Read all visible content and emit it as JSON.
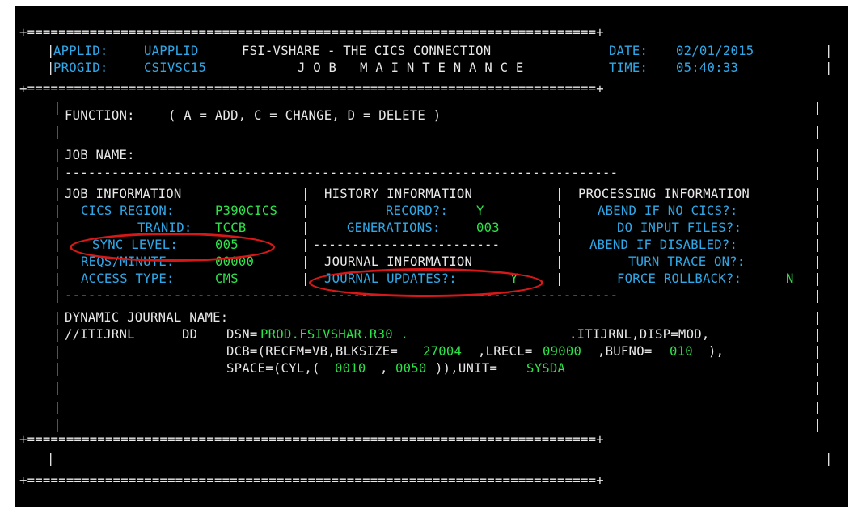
{
  "border_lines": {
    "top": "+=========================================================================+",
    "header_sep": "+=========================================================================+",
    "footer_sep": "+=========================================================================+",
    "bottom": "+=========================================================================+",
    "dash_1": "-----------------------------------------------------------------------",
    "dash_2": "-----------------------------------------------------------------------",
    "history_dash": "------------------------"
  },
  "header": {
    "applid_label": "APPLID:",
    "applid_value": "UAPPLID",
    "app_title": "FSI-VSHARE - THE CICS CONNECTION",
    "date_label": "DATE:",
    "date_value": "02/01/2015",
    "progid_label": "PROGID:",
    "progid_value": "CSIVSC15",
    "screen_title": "J O B   M A I N T E N A N C E",
    "time_label": "TIME:",
    "time_value": "05:40:33"
  },
  "function_line": {
    "label": "FUNCTION:",
    "options": "( A = ADD, C = CHANGE, D = DELETE )"
  },
  "job_name": {
    "label": "JOB NAME:"
  },
  "job_information": {
    "heading": "JOB INFORMATION",
    "cics_region_label": "CICS REGION:",
    "cics_region_value": "P390CICS",
    "tranid_label": "TRANID:",
    "tranid_value": "TCCB",
    "sync_level_label": "SYNC LEVEL:",
    "sync_level_value": "005",
    "reqs_minute_label": "REQS/MINUTE:",
    "reqs_minute_value": "00000",
    "access_type_label": "ACCESS TYPE:",
    "access_type_value": "CMS"
  },
  "history_information": {
    "heading": "HISTORY INFORMATION",
    "record_label": "RECORD?:",
    "record_value": "Y",
    "generations_label": "GENERATIONS:",
    "generations_value": "003"
  },
  "journal_information": {
    "heading": "JOURNAL INFORMATION",
    "journal_updates_label": "JOURNAL UPDATES?:",
    "journal_updates_value": "Y"
  },
  "processing_information": {
    "heading": "PROCESSING INFORMATION",
    "abend_no_cics_label": "ABEND IF NO CICS?:",
    "do_input_files_label": "DO INPUT FILES?:",
    "abend_disabled_label": "ABEND IF DISABLED?:",
    "turn_trace_label": "TURN TRACE ON?:",
    "force_rollback_label": "FORCE ROLLBACK?:",
    "force_rollback_value": "N"
  },
  "dynamic_journal": {
    "heading": "DYNAMIC JOURNAL NAME:",
    "ddname": "//ITIJRNL",
    "dd": "DD",
    "dsn_label": "DSN=",
    "dsn_prefix": "PROD.FSIVSHAR.R30 .",
    "dsn_suffix": ".ITIJRNL,DISP=MOD,",
    "dcb_open": "DCB=(RECFM=VB,BLKSIZE=",
    "blksize_value": "27004",
    "lrecl_label": ",LRECL=",
    "lrecl_value": "09000",
    "bufno_label": ",BUFNO=",
    "bufno_value": "010",
    "dcb_close": "),",
    "space_open": "SPACE=(CYL,(",
    "primary_value": "0010",
    "comma": ",",
    "secondary_value": "0050",
    "space_close": ")),UNIT=",
    "unit_value": "SYSDA"
  },
  "colors": {
    "background": "#000000",
    "text": "#e8e8e8",
    "border": "#2fa8e8",
    "field_value": "#2ee24a",
    "highlight": "#d81818"
  }
}
